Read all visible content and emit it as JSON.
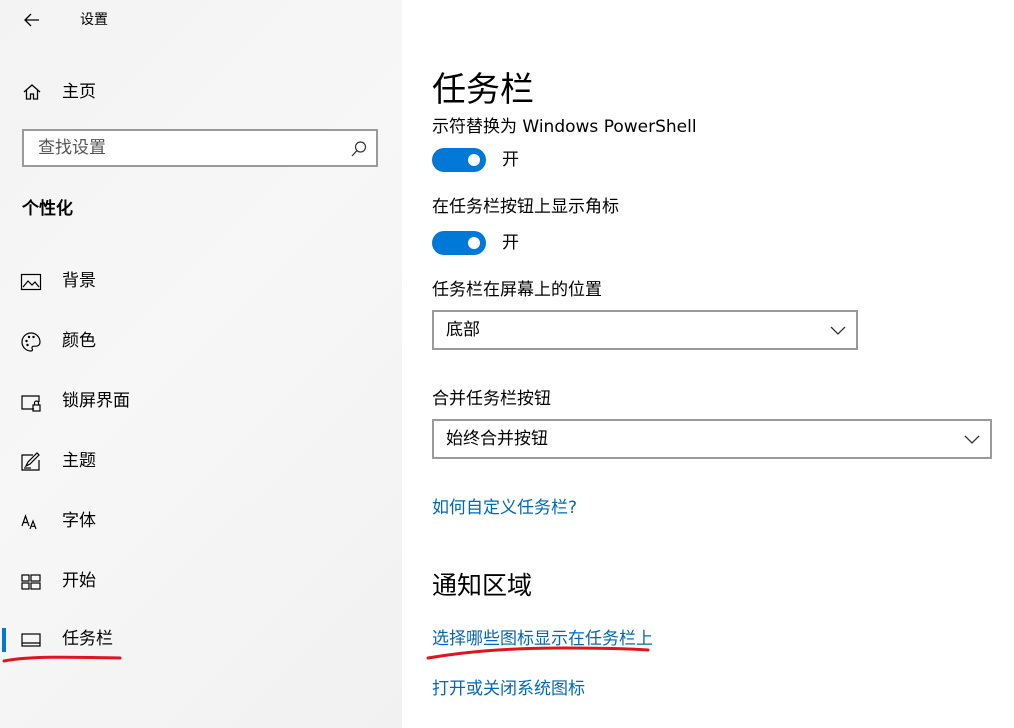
{
  "window": {
    "title": "设置"
  },
  "sidebar": {
    "home_label": "主页",
    "search_placeholder": "查找设置",
    "section_heading": "个性化",
    "items": [
      {
        "label": "背景",
        "icon": "picture-icon"
      },
      {
        "label": "颜色",
        "icon": "palette-icon"
      },
      {
        "label": "锁屏界面",
        "icon": "lock-screen-icon"
      },
      {
        "label": "主题",
        "icon": "theme-icon"
      },
      {
        "label": "字体",
        "icon": "font-icon"
      },
      {
        "label": "开始",
        "icon": "start-icon"
      },
      {
        "label": "任务栏",
        "icon": "taskbar-icon",
        "active": true
      }
    ]
  },
  "main": {
    "title": "任务栏",
    "cut_setting_label": "示符替换为 Windows PowerShell",
    "toggle1_state": "开",
    "setting2_label": "在任务栏按钮上显示角标",
    "toggle2_state": "开",
    "position_label": "任务栏在屏幕上的位置",
    "position_value": "底部",
    "combine_label": "合并任务栏按钮",
    "combine_value": "始终合并按钮",
    "help_link": "如何自定义任务栏?",
    "notify_heading": "通知区域",
    "notify_link1": "选择哪些图标显示在任务栏上",
    "notify_link2": "打开或关闭系统图标"
  },
  "colors": {
    "accent": "#0078d7",
    "link": "#0067b8",
    "annotation": "#e0141e"
  }
}
